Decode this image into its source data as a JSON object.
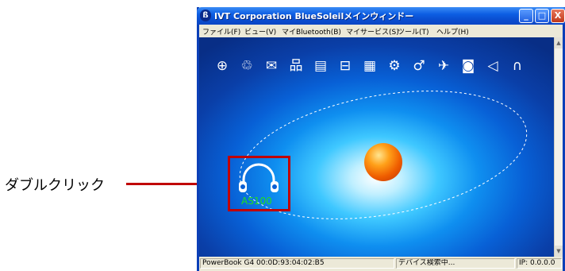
{
  "callout": {
    "label": "ダブルクリック"
  },
  "window": {
    "title": "IVT Corporation BlueSoleilメインウィンドー",
    "title_icon": "bluetooth-icon",
    "buttons": {
      "minimize": "_",
      "maximize": "□",
      "close": "X"
    }
  },
  "menu": [
    {
      "label": "ファイル(F)"
    },
    {
      "label": "ビュー(V)"
    },
    {
      "label": "マイBluetooth(B)"
    },
    {
      "label": "マイサービス(S)"
    },
    {
      "label": "ツール(T)"
    },
    {
      "label": "ヘルプ(H)"
    }
  ],
  "service_icons": [
    {
      "name": "network-access-icon",
      "glyph": "⊕"
    },
    {
      "name": "printer-service-icon",
      "glyph": "♲"
    },
    {
      "name": "file-transfer-icon",
      "glyph": "✉"
    },
    {
      "name": "pan-network-icon",
      "glyph": "品"
    },
    {
      "name": "object-push-icon",
      "glyph": "▤"
    },
    {
      "name": "lan-access-icon",
      "glyph": "⊟"
    },
    {
      "name": "serial-port-icon",
      "glyph": "▦"
    },
    {
      "name": "sync-icon",
      "glyph": "⚙"
    },
    {
      "name": "hid-mouse-icon",
      "glyph": "♂"
    },
    {
      "name": "fax-icon",
      "glyph": "✈"
    },
    {
      "name": "camera-icon",
      "glyph": "◙"
    },
    {
      "name": "audio-gateway-icon",
      "glyph": "◁"
    },
    {
      "name": "headset-service-icon",
      "glyph": "∩"
    }
  ],
  "device": {
    "label": "AS100",
    "icon": "headphones-icon"
  },
  "status": {
    "device_info": "PowerBook G4  00:0D:93:04:02:B5",
    "activity": "デバイス検索中...",
    "ip": "IP: 0.0.0.0"
  },
  "colors": {
    "highlight": "#c00000",
    "device_label": "#22dd22",
    "title_bar": "#0a4ed1"
  }
}
